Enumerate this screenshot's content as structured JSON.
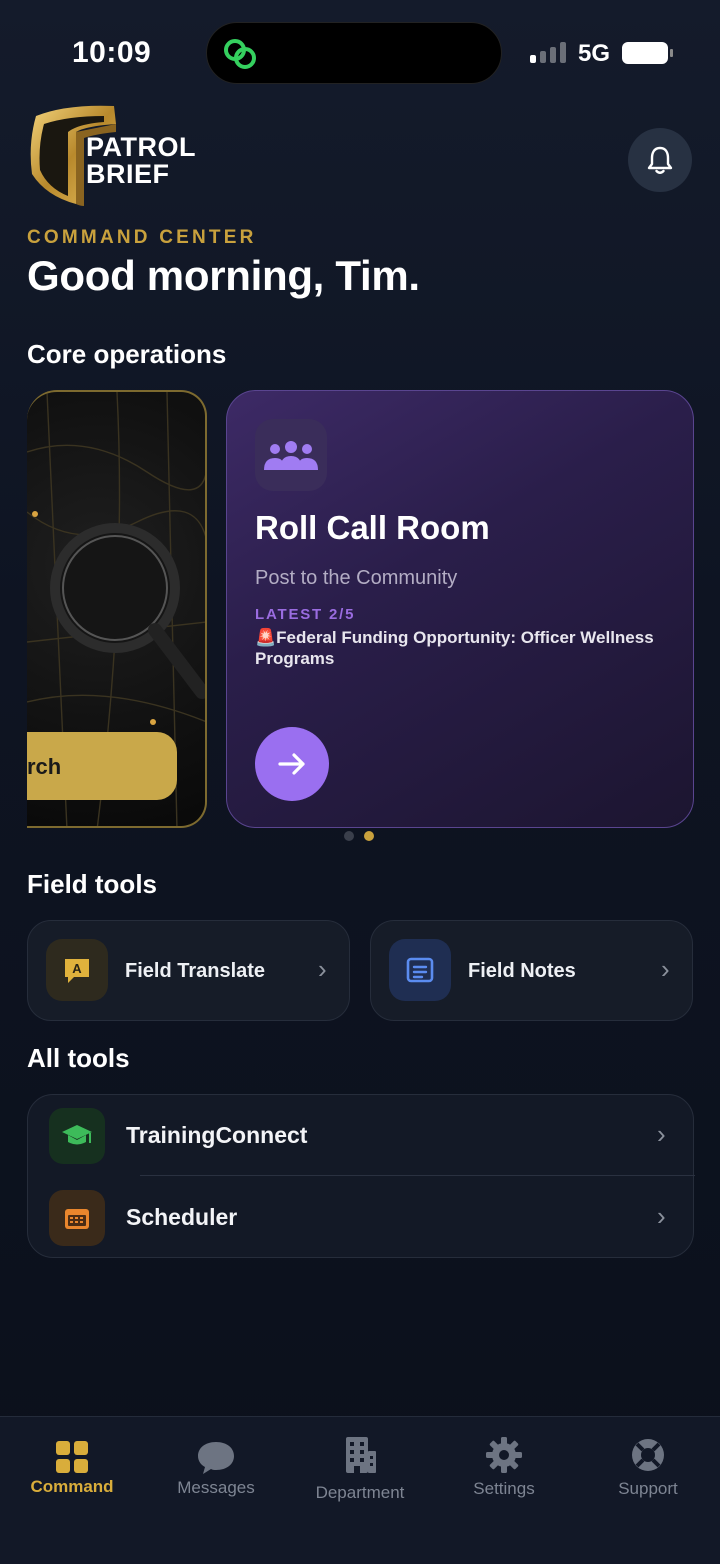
{
  "status": {
    "time": "10:09",
    "network": "5G"
  },
  "brand": {
    "line1": "PATROL",
    "line2": "BRIEF"
  },
  "header": {
    "kicker": "COMMAND CENTER",
    "greeting": "Good morning, Tim."
  },
  "core": {
    "title": "Core operations",
    "prev_card_button": "rch",
    "card": {
      "title": "Roll Call Room",
      "subtitle": "Post to the Community",
      "latest": "LATEST 2/5",
      "news": "🚨Federal Funding Opportunity: Officer Wellness Programs"
    },
    "page_count": 2,
    "active_page": 2
  },
  "field_tools": {
    "title": "Field tools",
    "items": [
      {
        "label": "Field Translate",
        "icon": "translate-icon"
      },
      {
        "label": "Field Notes",
        "icon": "notes-icon"
      }
    ]
  },
  "all_tools": {
    "title": "All tools",
    "items": [
      {
        "label": "TrainingConnect",
        "icon": "graduation-cap-icon"
      },
      {
        "label": "Scheduler",
        "icon": "calendar-icon"
      }
    ]
  },
  "tabbar": {
    "items": [
      {
        "label": "Command",
        "icon": "grid-icon",
        "active": true
      },
      {
        "label": "Messages",
        "icon": "chat-bubble-icon",
        "active": false
      },
      {
        "label": "Department",
        "icon": "building-icon",
        "active": false
      },
      {
        "label": "Settings",
        "icon": "gear-icon",
        "active": false
      },
      {
        "label": "Support",
        "icon": "lifebuoy-icon",
        "active": false
      }
    ]
  },
  "colors": {
    "gold": "#c9a13d",
    "purple": "#9a6ff0",
    "background": "#0e1422"
  }
}
